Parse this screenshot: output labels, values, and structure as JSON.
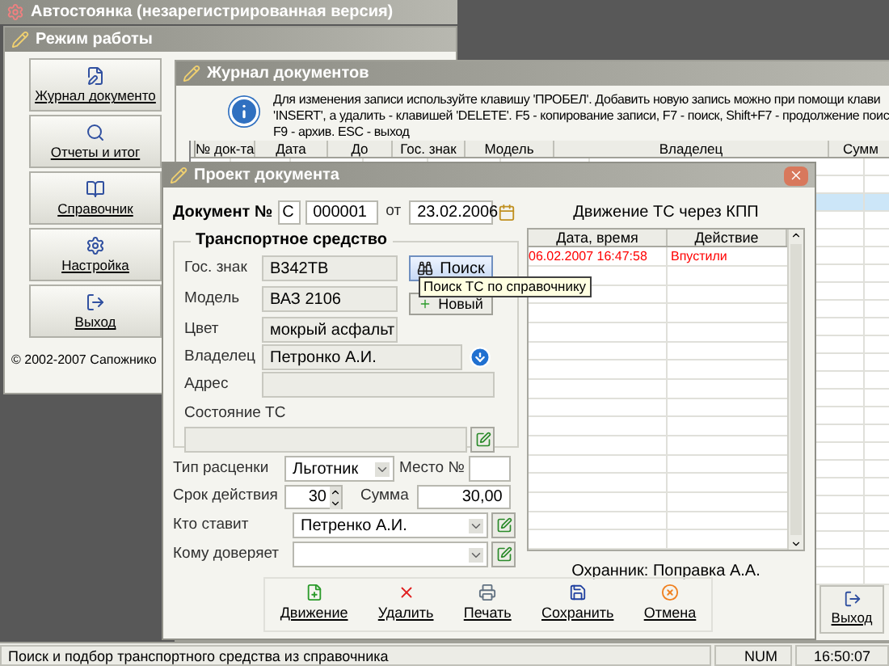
{
  "app_title": "Автостоянка (незарегистрированная версия)",
  "mode_window": {
    "title": "Режим работы",
    "buttons": [
      {
        "label": "Журнал документо",
        "kind": "journal"
      },
      {
        "label": "Отчеты и итог",
        "kind": "reports"
      },
      {
        "label": "Справочник",
        "kind": "reference"
      },
      {
        "label": "Настройка",
        "kind": "settings"
      },
      {
        "label": "Выход",
        "kind": "exit"
      }
    ],
    "copyright": "© 2002-2007 Сапожнико"
  },
  "journal_window": {
    "title": "Журнал документов",
    "info_lines": [
      "Для изменения записи используйте клавишу 'ПРОБЕЛ'. Добавить новую запись можно при помощи клави",
      "'INSERT', а удалить - клавишей 'DELETE'. F5 - копирование записи, F7 - поиск, Shift+F7 - продолжение поис",
      "F9 - архив. ESC - выход"
    ],
    "columns": [
      "№ док-та",
      "Дата",
      "До",
      "Гос. знак",
      "Модель",
      "Владелец",
      "Сумм"
    ],
    "rows": [
      {
        "selected": false
      },
      {
        "selected": false
      },
      {
        "selected": true
      },
      {
        "selected": false
      },
      {
        "selected": false
      },
      {
        "selected": false
      },
      {
        "selected": false
      },
      {
        "selected": false
      },
      {
        "selected": false
      },
      {
        "selected": false
      },
      {
        "selected": false
      },
      {
        "selected": false
      },
      {
        "selected": false
      },
      {
        "selected": false
      },
      {
        "selected": false
      },
      {
        "selected": false
      },
      {
        "selected": false
      },
      {
        "selected": false
      },
      {
        "selected": false
      },
      {
        "selected": false
      },
      {
        "selected": false
      },
      {
        "selected": false
      },
      {
        "selected": false
      },
      {
        "selected": false
      }
    ],
    "exit_button": "Выход"
  },
  "document_window": {
    "title": "Проект документа",
    "doc_label": "Документ №",
    "series": "С",
    "number": "000001",
    "date_label": "от",
    "date": "23.02.2006",
    "vehicle_group": "Транспортное средство",
    "plate_label": "Гос. знак",
    "plate": "B342TB",
    "model_label": "Модель",
    "model": "ВАЗ 2106",
    "color_label": "Цвет",
    "color_value": "мокрый асфальт",
    "owner_label": "Владелец",
    "owner": "Петронко А.И.",
    "address_label": "Адрес",
    "state_label": "Состояние ТС",
    "search_button": "Поиск",
    "new_button": "Новый",
    "tooltip": "Поиск ТС по справочнику",
    "rate_label": "Тип расценки",
    "rate": "Льготник",
    "place_label": "Место №",
    "term_label": "Срок действия",
    "term": "30",
    "sum_label": "Сумма",
    "sum": "30,00",
    "placer_label": "Кто ставит",
    "placer": "Петренко А.И.",
    "trustee_label": "Кому доверяет",
    "actions": [
      {
        "label": "Движение",
        "kind": "movement"
      },
      {
        "label": "Удалить",
        "kind": "delete"
      },
      {
        "label": "Печать",
        "kind": "print"
      },
      {
        "label": "Сохранить",
        "kind": "save"
      },
      {
        "label": "Отмена",
        "kind": "cancel"
      }
    ],
    "movement_title": "Движение ТС через КПП",
    "movement_columns": [
      "Дата, время",
      "Действие"
    ],
    "movements": [
      {
        "time": "06.02.2007 16:47:58",
        "action": "Впустили",
        "color": "#ff0000"
      }
    ],
    "guard": "Охранник: Поправка А.А."
  },
  "status_bar": {
    "message": "Поиск и подбор транспортного средства из справочника",
    "num": "NUM",
    "time": "16:50:07"
  }
}
